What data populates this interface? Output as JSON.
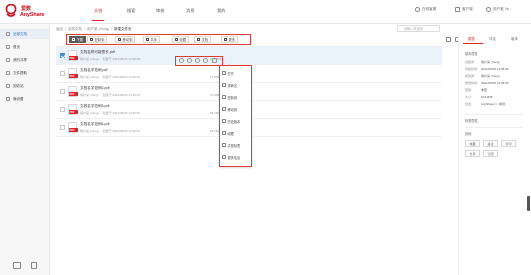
{
  "app": {
    "brand_cn": "爱数",
    "brand_en": "AnyShare",
    "brand_color": "#c8131f",
    "accent": "#e2242c"
  },
  "nav": [
    "文档",
    "搜索",
    "审核",
    "消息",
    "我的"
  ],
  "top_right": {
    "download": "在线客服",
    "client": "客户端",
    "user": "用户某 Ye..."
  },
  "sidebar": {
    "items": [
      {
        "label": "全部文档",
        "icon": "folder-icon"
      },
      {
        "label": "首页",
        "icon": "home-icon"
      },
      {
        "label": "我的共享",
        "icon": "share-icon"
      },
      {
        "label": "文件提取",
        "icon": "link-icon"
      },
      {
        "label": "回收站",
        "icon": "trash-icon"
      },
      {
        "label": "偏设置",
        "icon": "gear-icon"
      }
    ]
  },
  "breadcrumb": [
    "返回",
    "全部文档",
    "用户某 (Yang)",
    "新建文件夹"
  ],
  "search": {
    "placeholder": "请输入关键字"
  },
  "toolbar": [
    "下载",
    "复制到",
    "移动到",
    "共享",
    "收藏",
    "文档",
    "更多"
  ],
  "files": [
    {
      "name": "文档名称可能很长.pdf",
      "owner": "用户某 (Yang)",
      "time": "创建于 2021/05/26 14:38:35",
      "size": "104.4KB",
      "selected": true
    },
    {
      "name": "文档名字范例.pdf",
      "owner": "用户某 (Yang)",
      "time": "创建于 2021/05/26 14:36:35",
      "size": "57.8MB",
      "selected": false
    },
    {
      "name": "文档名字范例2.pdf",
      "owner": "用户某 (Yang)",
      "time": "创建于 2021/05/26 14:36:35",
      "size": "37.8MB",
      "selected": false
    },
    {
      "name": "文档名字范例3.pdf",
      "owner": "用户某 (Yang)",
      "time": "创建于 2021/05/26 14:36:35",
      "size": "96.2MB",
      "selected": false
    },
    {
      "name": "文档名字范例4.pdf",
      "owner": "用户某 (Yang)",
      "time": "创建于 2021/05/26 14:36:35",
      "size": "89.1MB",
      "selected": false
    }
  ],
  "row_actions": [
    "preview-icon",
    "share-icon",
    "link-icon",
    "download-icon",
    "more-icon"
  ],
  "menu": [
    "打开",
    "重命名",
    "复制到",
    "移动到",
    "历史版本",
    "收藏",
    "文档标签",
    "更多信息"
  ],
  "right_panel": {
    "tabs": [
      "属性",
      "评论",
      "版本"
    ],
    "basic_title": "基本属性",
    "props": [
      {
        "k": "创建者:",
        "v": "用户某 (Yang)"
      },
      {
        "k": "创建时间:",
        "v": "2021/05/26 14:38:35"
      },
      {
        "k": "修改者:",
        "v": "用户某 (Yang)"
      },
      {
        "k": "修改时间:",
        "v": "2021/05/26 14:38:35"
      },
      {
        "k": "密级:",
        "v": "非密"
      },
      {
        "k": "大小:",
        "v": "104.4KB"
      },
      {
        "k": "位置:",
        "v": "AnyShare://...新建..."
      }
    ],
    "tag_title": "标签属性",
    "other_title": "其他",
    "buttons": [
      "收藏",
      "关注",
      "打印",
      "分享",
      "订阅"
    ]
  }
}
